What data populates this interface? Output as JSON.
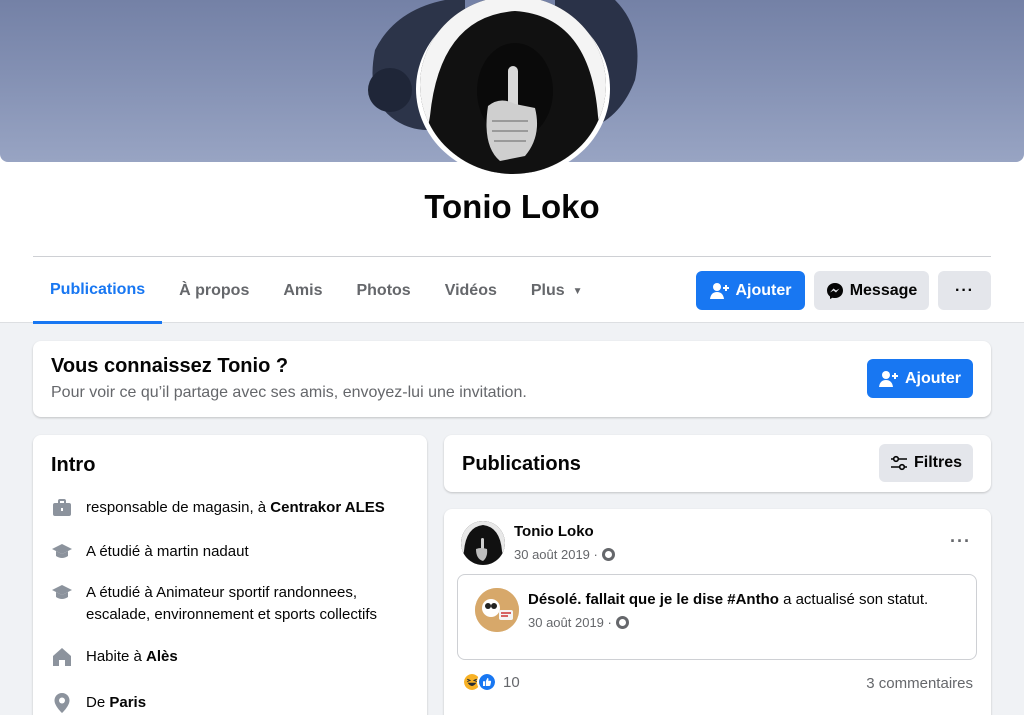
{
  "profile": {
    "name": "Tonio Loko"
  },
  "tabs": [
    {
      "label": "Publications",
      "active": true
    },
    {
      "label": "À propos"
    },
    {
      "label": "Amis"
    },
    {
      "label": "Photos"
    },
    {
      "label": "Vidéos"
    },
    {
      "label": "Plus"
    }
  ],
  "actions": {
    "add_label": "Ajouter",
    "message_label": "Message",
    "more_label": "···"
  },
  "know": {
    "title": "Vous connaissez Tonio ?",
    "subtitle": "Pour voir ce qu’il partage avec ses amis, envoyez-lui une invitation.",
    "add_label": "Ajouter"
  },
  "intro": {
    "title": "Intro",
    "work": {
      "prefix": "responsable de magasin, à ",
      "place": "Centrakor ALES"
    },
    "study1": "A étudié à martin nadaut",
    "study2": "A étudié à Animateur sportif randonnees, escalade, environnement et sports collectifs",
    "home": {
      "prefix": "Habite à ",
      "place": "Alès"
    },
    "from": {
      "prefix": "De ",
      "place": "Paris"
    }
  },
  "publications": {
    "title": "Publications",
    "filter_label": "Filtres"
  },
  "post": {
    "author": "Tonio Loko",
    "date": "30 août 2019 ·",
    "menu": "···",
    "shared": {
      "text_bold": "Désolé. fallait que je le dise #Antho",
      "text_rest": " a actualisé son statut.",
      "date": "30 août 2019 ·"
    },
    "reaction_count": "10",
    "comments": "3 commentaires"
  },
  "colors": {
    "accent": "#1877f2",
    "grey_button": "#e4e6eb",
    "page_bg": "#f0f2f5"
  }
}
